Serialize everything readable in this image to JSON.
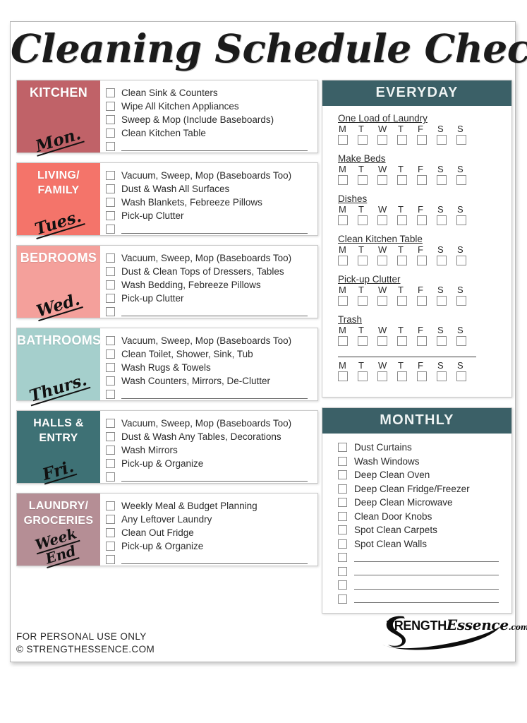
{
  "document": {
    "title": "Cleaning Schedule Checklist"
  },
  "weekly": [
    {
      "name_lines": [
        "KITCHEN"
      ],
      "day": "Mon.",
      "color": "#C06268",
      "tasks": [
        "Clean Sink & Counters",
        "Wipe All Kitchen Appliances",
        "Sweep & Mop (Include Baseboards)",
        "Clean Kitchen Table"
      ],
      "blank_rows": 1
    },
    {
      "name_lines": [
        "LIVING/",
        "FAMILY"
      ],
      "day": "Tues.",
      "color": "#F4746A",
      "tasks": [
        "Vacuum, Sweep, Mop (Baseboards Too)",
        "Dust & Wash All Surfaces",
        "Wash Blankets, Febreeze Pillows",
        "Pick-up Clutter"
      ],
      "blank_rows": 1
    },
    {
      "name_lines": [
        "BEDROOMS"
      ],
      "day": "Wed.",
      "color": "#F4A09B",
      "tasks": [
        "Vacuum, Sweep, Mop (Baseboards Too)",
        "Dust & Clean Tops of Dressers, Tables",
        "Wash Bedding, Febreeze Pillows",
        "Pick-up Clutter"
      ],
      "blank_rows": 1
    },
    {
      "name_lines": [
        "BATHROOMS"
      ],
      "day": "Thurs.",
      "color": "#A5CFCC",
      "tasks": [
        "Vacuum, Sweep, Mop (Baseboards Too)",
        "Clean Toilet, Shower, Sink, Tub",
        "Wash Rugs & Towels",
        "Wash Counters, Mirrors, De-Clutter"
      ],
      "blank_rows": 1
    },
    {
      "name_lines": [
        "HALLS &",
        "ENTRY"
      ],
      "day": "Fri.",
      "color": "#3E7175",
      "tasks": [
        "Vacuum, Sweep, Mop (Baseboards Too)",
        "Dust & Wash Any Tables, Decorations",
        "Wash Mirrors",
        "Pick-up & Organize"
      ],
      "blank_rows": 1
    },
    {
      "name_lines": [
        "LAUNDRY/",
        "GROCERIES"
      ],
      "day": "Week End",
      "color": "#B58E95",
      "tasks": [
        "Weekly Meal & Budget Planning",
        "Any Leftover Laundry",
        "Clean Out Fridge",
        "Pick-up & Organize"
      ],
      "blank_rows": 1
    }
  ],
  "everyday": {
    "heading": "EVERYDAY",
    "days": [
      "M",
      "T",
      "W",
      "T",
      "F",
      "S",
      "S"
    ],
    "items": [
      "One Load of Laundry",
      "Make Beds",
      "Dishes",
      "Clean Kitchen Table",
      "Pick-up Clutter",
      "Trash"
    ],
    "blank_rows": 1
  },
  "monthly": {
    "heading": "MONTHLY",
    "items": [
      "Dust Curtains",
      "Wash Windows",
      "Deep Clean Oven",
      "Deep Clean Fridge/Freezer",
      "Deep Clean Microwave",
      "Clean Door Knobs",
      "Spot Clean Carpets",
      "Spot Clean Walls"
    ],
    "blank_rows": 4
  },
  "footer": {
    "line1": "FOR PERSONAL USE ONLY",
    "line2": "© STRENGTHESSENCE.COM",
    "logo_strength": "TRENGTH",
    "logo_essence": "Essence",
    "logo_dotcom": ".com"
  },
  "colors": {
    "panel_header": "#3b6067",
    "kitchen": "#C06268",
    "living": "#F4746A",
    "bedrooms": "#F4A09B",
    "bathrooms": "#A5CFCC",
    "halls": "#3E7175",
    "laundry": "#B58E95"
  }
}
